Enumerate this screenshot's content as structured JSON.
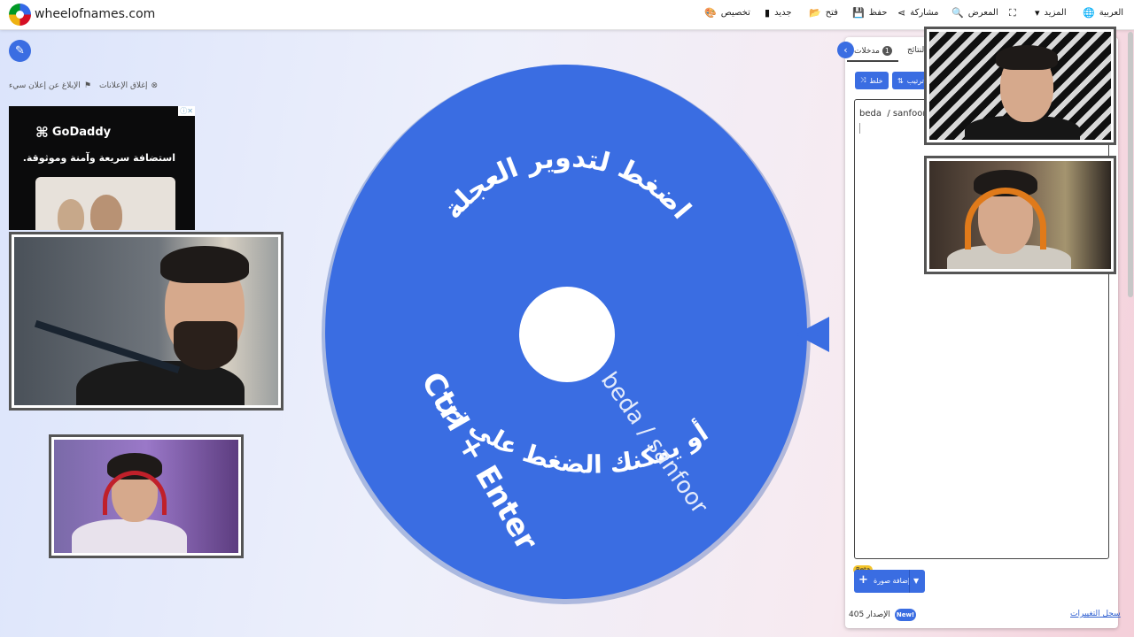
{
  "site": {
    "name": "wheelofnames.com"
  },
  "nav": {
    "language": "العربية",
    "more": "المزيد",
    "gallery": "المعرض",
    "share": "مشاركة",
    "save": "حفظ",
    "open": "فتح",
    "new": "جديد",
    "customize": "تخصيص"
  },
  "ads": {
    "report_label": "الإبلاغ عن إعلان سيء",
    "close_label": "إغلاق الإعلانات",
    "brand": "GoDaddy",
    "tagline": "استضافة سريعة وآمنة وموثوقة."
  },
  "wheel": {
    "line1": "اضغط لتدوير العجلة",
    "line2": "أو يمكنك الضغط على زر",
    "line3": "Ctrl + Enter",
    "entry_label": "beda  / sanfoor",
    "color": "#3a6de2"
  },
  "panel": {
    "tab_entries": "مدخلات",
    "tab_entries_count": "1",
    "tab_results": "النتائج",
    "shuffle_label": "خلط",
    "sort_label": "ترتيب",
    "entries": [
      "beda  / sanfoor"
    ],
    "add_image_label": "إضافة صورة",
    "beta_label": "Beta",
    "version_label": "الإصدار 405",
    "new_label": "New!",
    "changelog_label": "سجل التغييرات"
  }
}
